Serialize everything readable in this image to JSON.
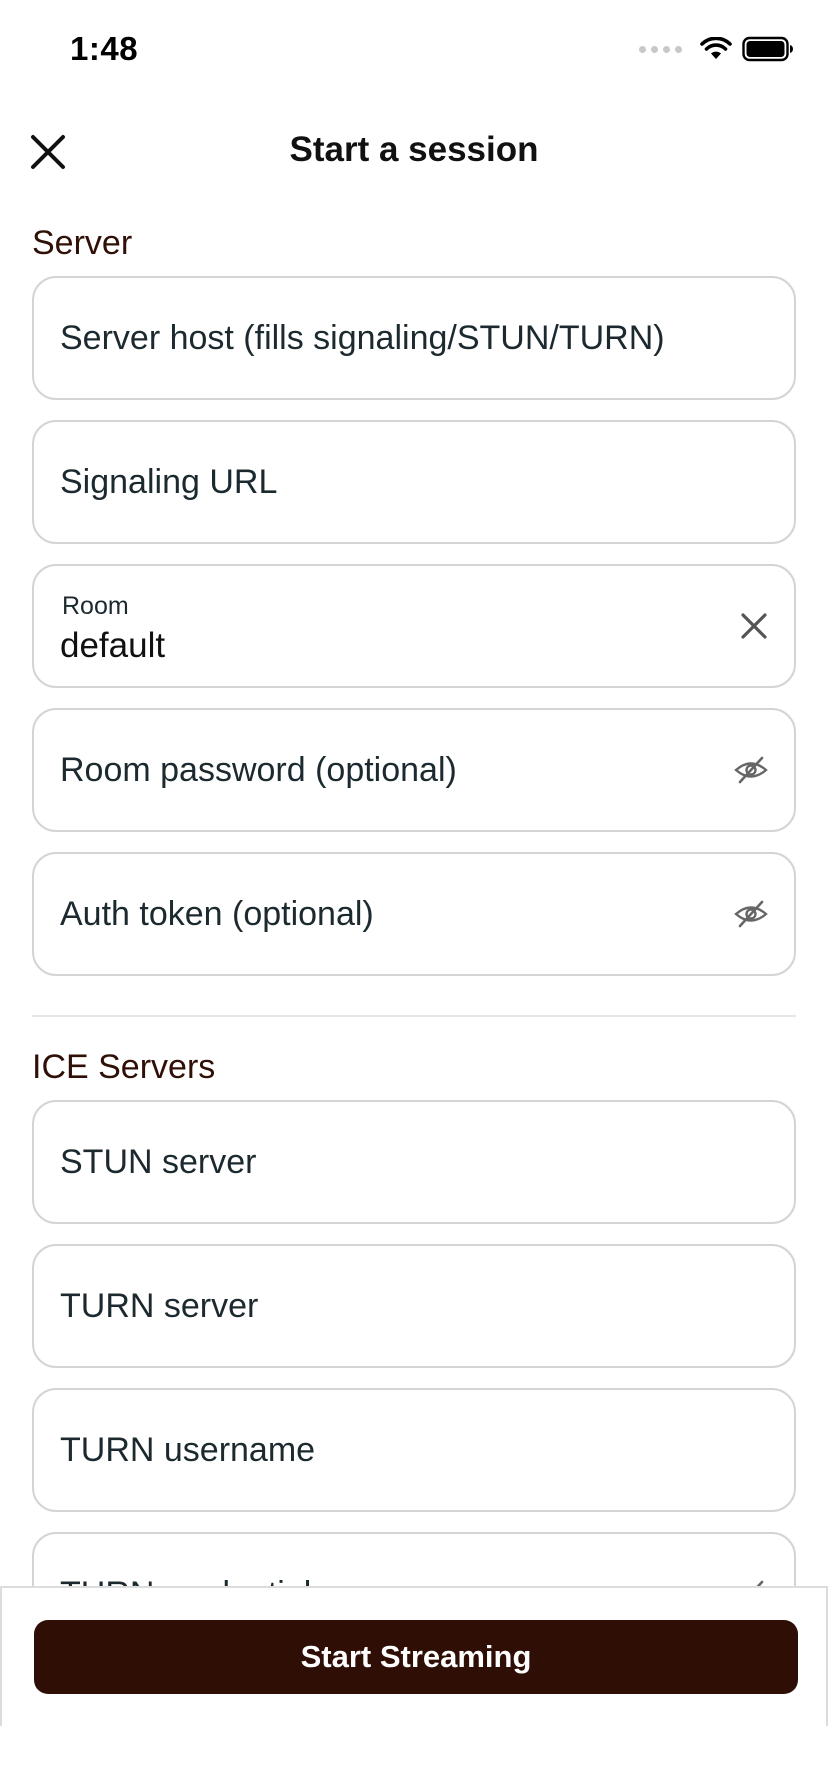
{
  "status_bar": {
    "time": "1:48"
  },
  "nav": {
    "title": "Start a session"
  },
  "server_section": {
    "label": "Server",
    "fields": {
      "server_host": {
        "placeholder": "Server host (fills signaling/STUN/TURN)"
      },
      "signaling_url": {
        "placeholder": "Signaling URL"
      },
      "room": {
        "label": "Room",
        "value": "default"
      },
      "room_password": {
        "placeholder": "Room password (optional)"
      },
      "auth_token": {
        "placeholder": "Auth token (optional)"
      }
    }
  },
  "ice_section": {
    "label": "ICE Servers",
    "fields": {
      "stun_server": {
        "placeholder": "STUN server"
      },
      "turn_server": {
        "placeholder": "TURN server"
      },
      "turn_username": {
        "placeholder": "TURN username"
      },
      "turn_credential": {
        "placeholder": "TURN credential"
      }
    }
  },
  "footer": {
    "start_label": "Start Streaming"
  },
  "colors": {
    "primary": "#2f0f05",
    "section_label": "#2f0f06",
    "field_border": "#d4d4d4"
  },
  "icons": {
    "close": "close-icon",
    "clear": "clear-icon",
    "visibility_off": "eye-off-icon",
    "wifi": "wifi-icon",
    "battery": "battery-icon",
    "signal": "cellular-signal-icon"
  }
}
